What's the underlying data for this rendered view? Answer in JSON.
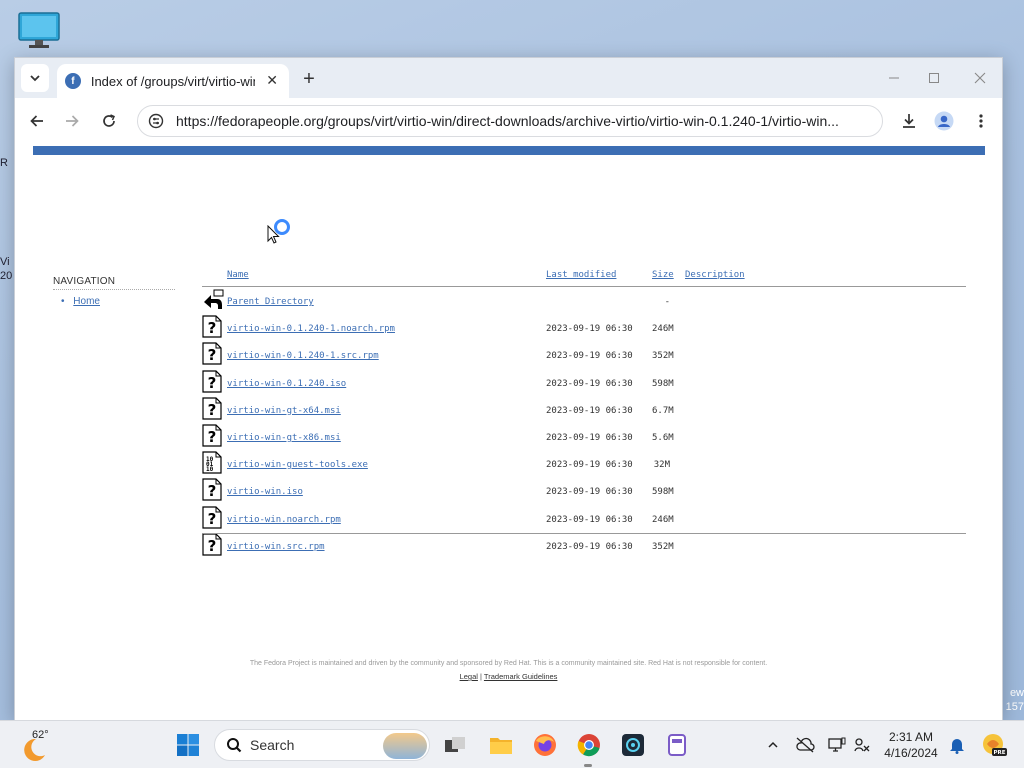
{
  "desktop": {
    "left_edge_fragments": [
      "R",
      "Vi",
      "20"
    ],
    "right_edge_fragments": [
      "ew",
      "157"
    ]
  },
  "browser": {
    "tab": {
      "title": "Index of /groups/virt/virtio-win"
    },
    "url": "https://fedorapeople.org/groups/virt/virtio-win/direct-downloads/archive-virtio/virtio-win-0.1.240-1/virtio-win..."
  },
  "page": {
    "navigation": {
      "heading": "NAVIGATION",
      "home": "Home"
    },
    "listing": {
      "headers": {
        "name": "Name",
        "last_modified": "Last modified",
        "size": "Size",
        "description": "Description"
      },
      "parent": {
        "name": "Parent Directory",
        "size": "-"
      },
      "rows": [
        {
          "icon": "unknown-file-icon",
          "name": "virtio-win-0.1.240-1.noarch.rpm",
          "modified": "2023-09-19 06:30",
          "size": "246M"
        },
        {
          "icon": "unknown-file-icon",
          "name": "virtio-win-0.1.240-1.src.rpm",
          "modified": "2023-09-19 06:30",
          "size": "352M"
        },
        {
          "icon": "unknown-file-icon",
          "name": "virtio-win-0.1.240.iso",
          "modified": "2023-09-19 06:30",
          "size": "598M"
        },
        {
          "icon": "unknown-file-icon",
          "name": "virtio-win-gt-x64.msi",
          "modified": "2023-09-19 06:30",
          "size": "6.7M"
        },
        {
          "icon": "unknown-file-icon",
          "name": "virtio-win-gt-x86.msi",
          "modified": "2023-09-19 06:30",
          "size": "5.6M"
        },
        {
          "icon": "binary-file-icon",
          "name": "virtio-win-guest-tools.exe",
          "modified": "2023-09-19 06:30",
          "size": "32M"
        },
        {
          "icon": "unknown-file-icon",
          "name": "virtio-win.iso",
          "modified": "2023-09-19 06:30",
          "size": "598M"
        },
        {
          "icon": "unknown-file-icon",
          "name": "virtio-win.noarch.rpm",
          "modified": "2023-09-19 06:30",
          "size": "246M"
        },
        {
          "icon": "unknown-file-icon",
          "name": "virtio-win.src.rpm",
          "modified": "2023-09-19 06:30",
          "size": "352M"
        }
      ]
    },
    "footer": {
      "text": "The Fedora Project is maintained and driven by the community and sponsored by Red Hat. This is a community maintained site. Red Hat is not responsible for content.",
      "legal": "Legal",
      "separator": "|",
      "trademark": "Trademark Guidelines"
    }
  },
  "taskbar": {
    "weather_temp": "62°",
    "search_label": "Search",
    "time": "2:31 AM",
    "date": "4/16/2024",
    "pre_badge": "PRE"
  },
  "colors": {
    "link": "#3c6eb4",
    "fedora_blue": "#3c6eb4",
    "loading_ring": "#3d8bfd"
  }
}
